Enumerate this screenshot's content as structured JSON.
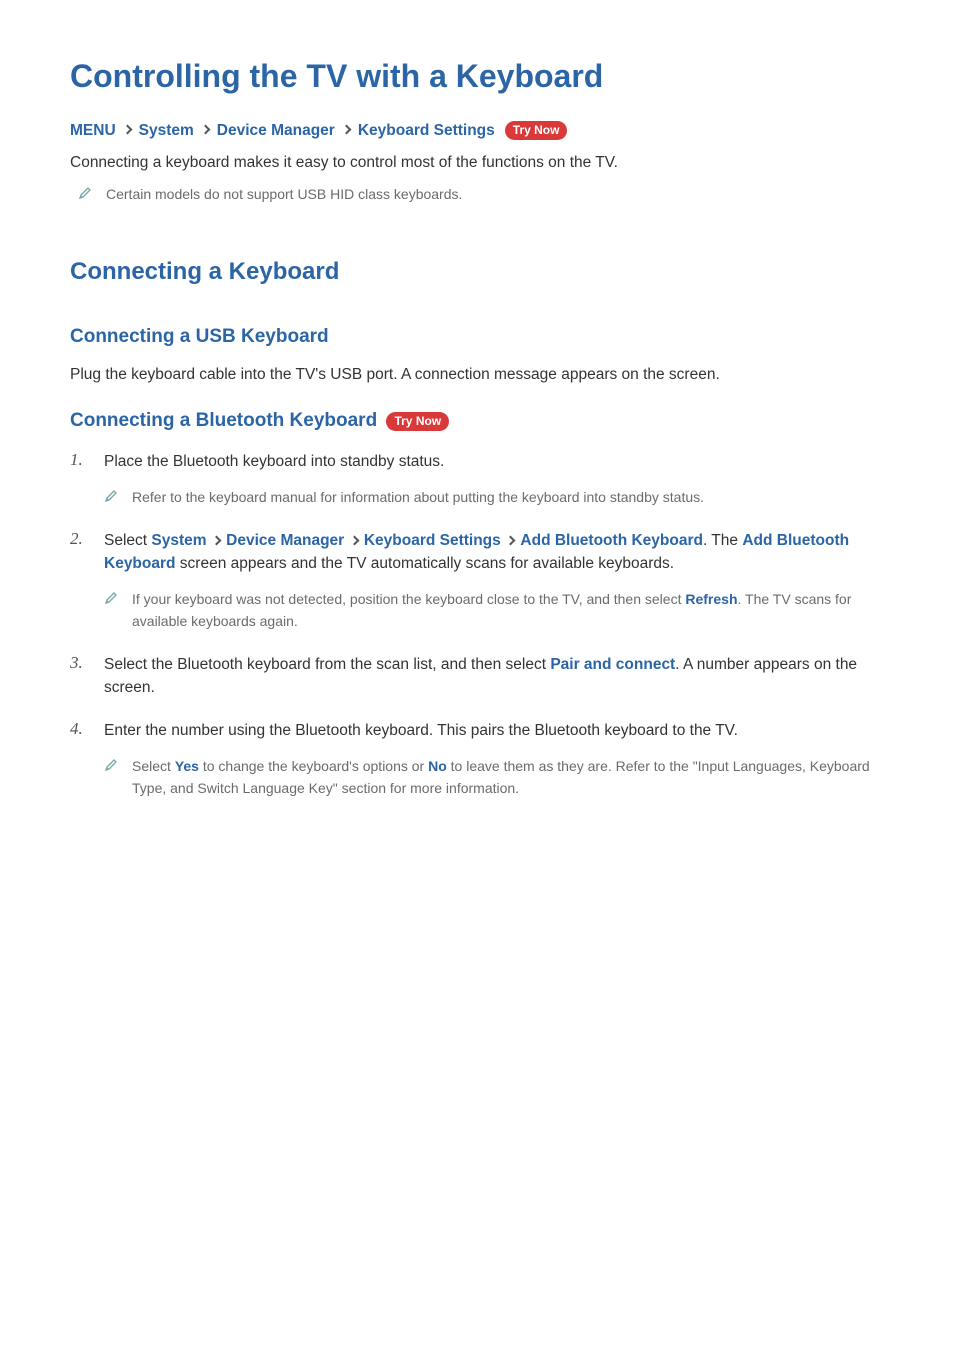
{
  "title": "Controlling the TV with a Keyboard",
  "try_now_label": "Try Now",
  "nav": {
    "segments": [
      "MENU",
      "System",
      "Device Manager",
      "Keyboard Settings"
    ]
  },
  "intro": "Connecting a keyboard makes it easy to control most of the functions on the TV.",
  "note_top": "Certain models do not support USB HID class keyboards.",
  "h2_connecting": "Connecting a Keyboard",
  "usb": {
    "title": "Connecting a USB Keyboard",
    "body": "Plug the keyboard cable into the TV's USB port. A connection message appears on the screen."
  },
  "bt": {
    "title": "Connecting a Bluetooth Keyboard",
    "steps": {
      "n1": "1.",
      "s1": "Place the Bluetooth keyboard into standby status.",
      "s1_note": "Refer to the keyboard manual for information about putting the keyboard into standby status.",
      "n2": "2.",
      "s2_pre": "Select ",
      "s2_path": [
        "System",
        "Device Manager",
        "Keyboard Settings",
        "Add Bluetooth Keyboard"
      ],
      "s2_mid": ". The ",
      "s2_label": "Add Bluetooth Keyboard",
      "s2_post": " screen appears and the TV automatically scans for available keyboards.",
      "s2_note_pre": "If your keyboard was not detected, position the keyboard close to the TV, and then select ",
      "s2_note_label": "Refresh",
      "s2_note_post": ". The TV scans for available keyboards again.",
      "n3": "3.",
      "s3_pre": "Select the Bluetooth keyboard from the scan list, and then select ",
      "s3_label": "Pair and connect",
      "s3_post": ". A number appears on the screen.",
      "n4": "4.",
      "s4": "Enter the number using the Bluetooth keyboard. This pairs the Bluetooth keyboard to the TV.",
      "s4_note_pre": "Select ",
      "s4_note_yes": "Yes",
      "s4_note_mid": " to change the keyboard's options or ",
      "s4_note_no": "No",
      "s4_note_post": " to leave them as they are. Refer to the \"Input Languages, Keyboard Type, and Switch Language Key\" section for more information."
    }
  }
}
